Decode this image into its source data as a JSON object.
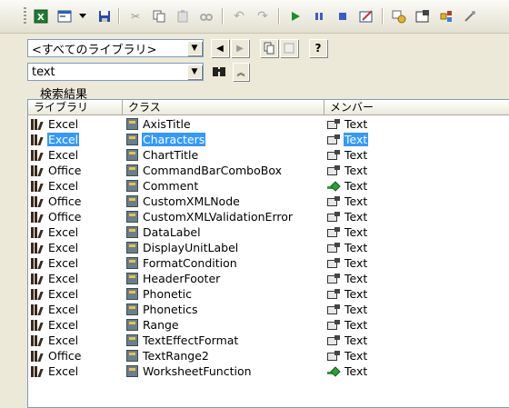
{
  "colors": {
    "accent": "#3399ff",
    "panel": "#ece9d8"
  },
  "toolbar": {
    "icons": [
      "excel-icon",
      "userform-icon",
      "insert-dropdown-icon",
      "save-icon",
      "cut-icon",
      "copy-icon",
      "paste-icon",
      "find-icon",
      "undo-icon",
      "redo-icon",
      "run-icon",
      "break-icon",
      "reset-icon",
      "design-mode-icon",
      "project-explorer-icon",
      "properties-icon",
      "object-browser-icon",
      "toolbox-icon"
    ]
  },
  "library_select": {
    "value": "<すべてのライブラリ>"
  },
  "search": {
    "value": "text"
  },
  "results": {
    "label": "検索結果",
    "columns": [
      "ライブラリ",
      "クラス",
      "メンバー"
    ],
    "rows": [
      {
        "library": "Excel",
        "class": "AxisTitle",
        "member": "Text",
        "member_type": "property"
      },
      {
        "library": "Excel",
        "class": "Characters",
        "member": "Text",
        "member_type": "property",
        "selected": true
      },
      {
        "library": "Excel",
        "class": "ChartTitle",
        "member": "Text",
        "member_type": "property"
      },
      {
        "library": "Office",
        "class": "CommandBarComboBox",
        "member": "Text",
        "member_type": "property"
      },
      {
        "library": "Excel",
        "class": "Comment",
        "member": "Text",
        "member_type": "method"
      },
      {
        "library": "Office",
        "class": "CustomXMLNode",
        "member": "Text",
        "member_type": "property"
      },
      {
        "library": "Office",
        "class": "CustomXMLValidationError",
        "member": "Text",
        "member_type": "property"
      },
      {
        "library": "Excel",
        "class": "DataLabel",
        "member": "Text",
        "member_type": "property"
      },
      {
        "library": "Excel",
        "class": "DisplayUnitLabel",
        "member": "Text",
        "member_type": "property"
      },
      {
        "library": "Excel",
        "class": "FormatCondition",
        "member": "Text",
        "member_type": "property"
      },
      {
        "library": "Excel",
        "class": "HeaderFooter",
        "member": "Text",
        "member_type": "property"
      },
      {
        "library": "Excel",
        "class": "Phonetic",
        "member": "Text",
        "member_type": "property"
      },
      {
        "library": "Excel",
        "class": "Phonetics",
        "member": "Text",
        "member_type": "property"
      },
      {
        "library": "Excel",
        "class": "Range",
        "member": "Text",
        "member_type": "property"
      },
      {
        "library": "Excel",
        "class": "TextEffectFormat",
        "member": "Text",
        "member_type": "property"
      },
      {
        "library": "Office",
        "class": "TextRange2",
        "member": "Text",
        "member_type": "property"
      },
      {
        "library": "Excel",
        "class": "WorksheetFunction",
        "member": "Text",
        "member_type": "method"
      }
    ]
  }
}
